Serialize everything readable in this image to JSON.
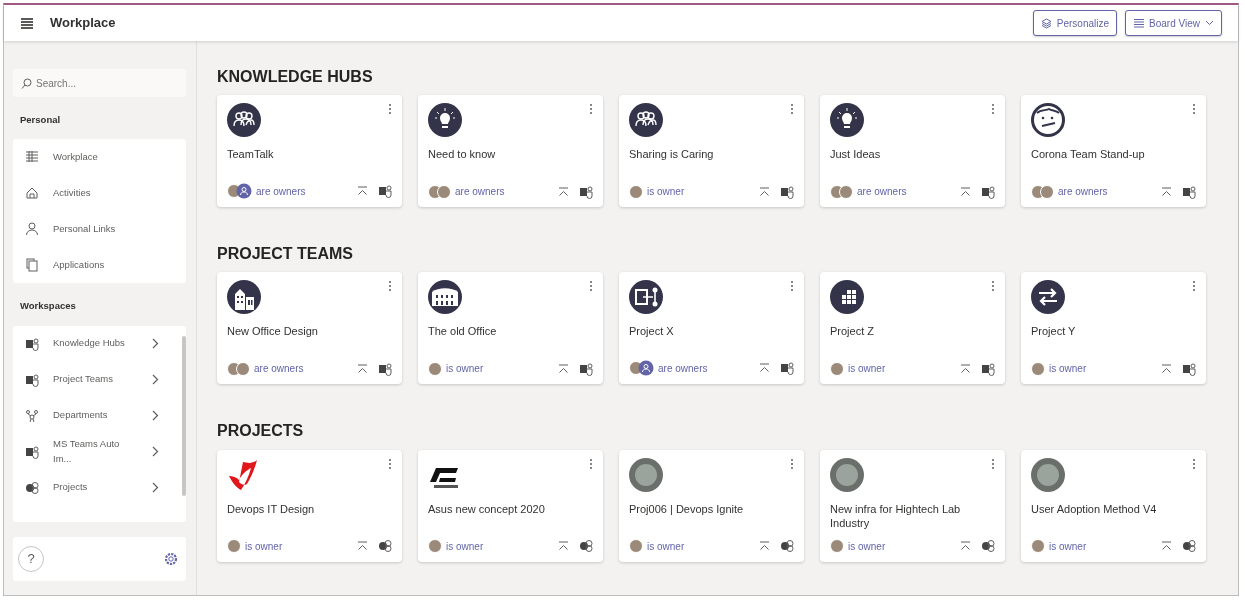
{
  "header": {
    "title": "Workplace",
    "buttons": [
      {
        "label": "Personalize",
        "kind": "layers"
      },
      {
        "label": "Board View",
        "kind": "list",
        "dropdown": true
      }
    ]
  },
  "sidebar": {
    "search": {
      "placeholder": "Search..."
    },
    "personal": {
      "heading": "Personal",
      "items": [
        {
          "label": "Workplace",
          "kind": "grid"
        },
        {
          "label": "Activities",
          "kind": "home"
        },
        {
          "label": "Personal Links",
          "kind": "person"
        },
        {
          "label": "Applications",
          "kind": "pages"
        }
      ]
    },
    "workspaces": {
      "heading": "Workspaces",
      "items": [
        {
          "label": "Knowledge Hubs",
          "kind": "teams"
        },
        {
          "label": "Project Teams",
          "kind": "teams"
        },
        {
          "label": "Departments",
          "kind": "org"
        },
        {
          "label": "MS Teams Auto Im...",
          "kind": "teams"
        },
        {
          "label": "Projects",
          "kind": "project"
        }
      ]
    },
    "footer": {
      "help": "?"
    }
  },
  "sections": [
    {
      "title": "KNOWLEDGE HUBS",
      "cards": [
        {
          "title": "TeamTalk",
          "icon": {
            "kind": "group"
          },
          "owners": [
            {
              "kind": "photo"
            },
            {
              "kind": "person"
            }
          ],
          "owner_text": "are owners",
          "app": {
            "kind": "teams"
          }
        },
        {
          "title": "Need to know",
          "icon": {
            "kind": "bulb"
          },
          "owners": [
            {
              "kind": "photo"
            },
            {
              "kind": "photo"
            }
          ],
          "owner_text": "are owners",
          "app": {
            "kind": "teams"
          }
        },
        {
          "title": "Sharing is Caring",
          "icon": {
            "kind": "group"
          },
          "owners": [
            {
              "kind": "photo"
            }
          ],
          "owner_text": "is owner",
          "app": {
            "kind": "teams"
          }
        },
        {
          "title": "Just Ideas",
          "icon": {
            "kind": "bulb"
          },
          "owners": [
            {
              "kind": "photo"
            },
            {
              "kind": "photo"
            }
          ],
          "owner_text": "are owners",
          "app": {
            "kind": "teams"
          }
        },
        {
          "title": "Corona Team Stand-up",
          "icon": {
            "kind": "face"
          },
          "owners": [
            {
              "kind": "photo"
            },
            {
              "kind": "photo"
            }
          ],
          "owner_text": "are owners",
          "app": {
            "kind": "teams"
          }
        }
      ]
    },
    {
      "title": "PROJECT TEAMS",
      "cards": [
        {
          "title": "New Office Design",
          "icon": {
            "kind": "building"
          },
          "owners": [
            {
              "kind": "photo"
            },
            {
              "kind": "photo"
            }
          ],
          "owner_text": "are owners",
          "app": {
            "kind": "teams"
          }
        },
        {
          "title": "The old Office",
          "icon": {
            "kind": "colosseum"
          },
          "owners": [
            {
              "kind": "photo"
            }
          ],
          "owner_text": "is owner",
          "app": {
            "kind": "teams"
          }
        },
        {
          "title": "Project X",
          "icon": {
            "kind": "share"
          },
          "owners": [
            {
              "kind": "photo"
            },
            {
              "kind": "person"
            }
          ],
          "owner_text": "are owners",
          "app": {
            "kind": "teams"
          }
        },
        {
          "title": "Project Z",
          "icon": {
            "kind": "blocks"
          },
          "owners": [
            {
              "kind": "photo"
            }
          ],
          "owner_text": "is owner",
          "app": {
            "kind": "teams"
          }
        },
        {
          "title": "Project Y",
          "icon": {
            "kind": "swap"
          },
          "owners": [
            {
              "kind": "photo"
            }
          ],
          "owner_text": "is owner",
          "app": {
            "kind": "teams"
          }
        }
      ]
    },
    {
      "title": "PROJECTS",
      "cards": [
        {
          "title": "Devops IT Design",
          "icon": {
            "kind": "swoosh"
          },
          "owners": [
            {
              "kind": "photo"
            }
          ],
          "owner_text": "is owner",
          "app": {
            "kind": "project"
          }
        },
        {
          "title": "Asus new concept 2020",
          "icon": {
            "kind": "logo"
          },
          "owners": [
            {
              "kind": "photo"
            }
          ],
          "owner_text": "is owner",
          "app": {
            "kind": "project"
          }
        },
        {
          "title": "Proj006 | Devops Ignite",
          "icon": {
            "kind": "photo"
          },
          "owners": [
            {
              "kind": "photo"
            }
          ],
          "owner_text": "is owner",
          "app": {
            "kind": "project"
          }
        },
        {
          "title": "New infra for Hightech Lab Industry",
          "icon": {
            "kind": "photo"
          },
          "owners": [
            {
              "kind": "photo"
            }
          ],
          "owner_text": "is owner",
          "app": {
            "kind": "project"
          }
        },
        {
          "title": "User Adoption Method V4",
          "icon": {
            "kind": "photo"
          },
          "owners": [
            {
              "kind": "photo"
            }
          ],
          "owner_text": "is owner",
          "app": {
            "kind": "project"
          }
        }
      ]
    }
  ]
}
